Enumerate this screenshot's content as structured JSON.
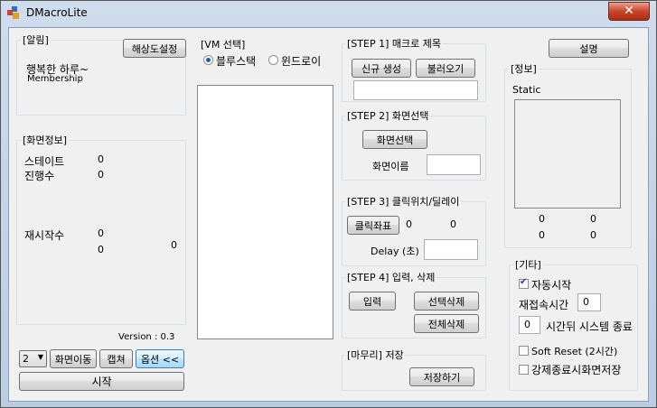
{
  "window": {
    "title": "DMacroLite",
    "close_label": "✕"
  },
  "alarm": {
    "legend": "[알림]",
    "resolution_button": "해상도설정",
    "line1": "행복한 하루~",
    "line2": "Membership"
  },
  "screen_info": {
    "legend": "[화면정보]",
    "state_label": "스테이트",
    "state_value": "0",
    "progress_label": "진행수",
    "progress_value": "0",
    "restart_label": "재시작수",
    "restart_value": "0",
    "extra_value1": "0",
    "extra_value2": "0"
  },
  "version": "Version : 0.3",
  "bottom_bar": {
    "combo_value": "2",
    "move_screen": "화면이동",
    "capture": "캡쳐",
    "options": "옵션 <<",
    "start": "시작"
  },
  "vm": {
    "legend": "[VM 선택]",
    "option1": "블루스택",
    "option2": "윈드로이"
  },
  "step1": {
    "legend": "[STEP 1] 매크로 제목",
    "new_button": "신규 생성",
    "load_button": "불러오기",
    "title_value": ""
  },
  "step2": {
    "legend": "[STEP 2] 화면선택",
    "select_button": "화면선택",
    "name_label": "화면이름",
    "name_value": ""
  },
  "step3": {
    "legend": "[STEP 3] 클릭위치/딜레이",
    "coord_button": "클릭좌표",
    "x_value": "0",
    "y_value": "0",
    "delay_label": "Delay (초)",
    "delay_value": ""
  },
  "step4": {
    "legend": "[STEP 4] 입력, 삭제",
    "input_button": "입력",
    "delete_selected": "선택삭제",
    "delete_all": "전체삭제"
  },
  "finish": {
    "legend": "[마무리] 저장",
    "save_button": "저장하기"
  },
  "help_button": "설명",
  "info": {
    "legend": "[정보]",
    "static_label": "Static",
    "v1": "0",
    "v2": "0",
    "v3": "0",
    "v4": "0"
  },
  "etc": {
    "legend": "[기타]",
    "auto_start": "자동시작",
    "auto_start_checked": true,
    "reconnect_label": "재접속시간",
    "reconnect_value": "0",
    "shutdown_value": "0",
    "shutdown_label": "시간뒤 시스템 종료",
    "soft_reset": "Soft Reset (2시간)",
    "force_save": "강제종료시화면저장"
  }
}
